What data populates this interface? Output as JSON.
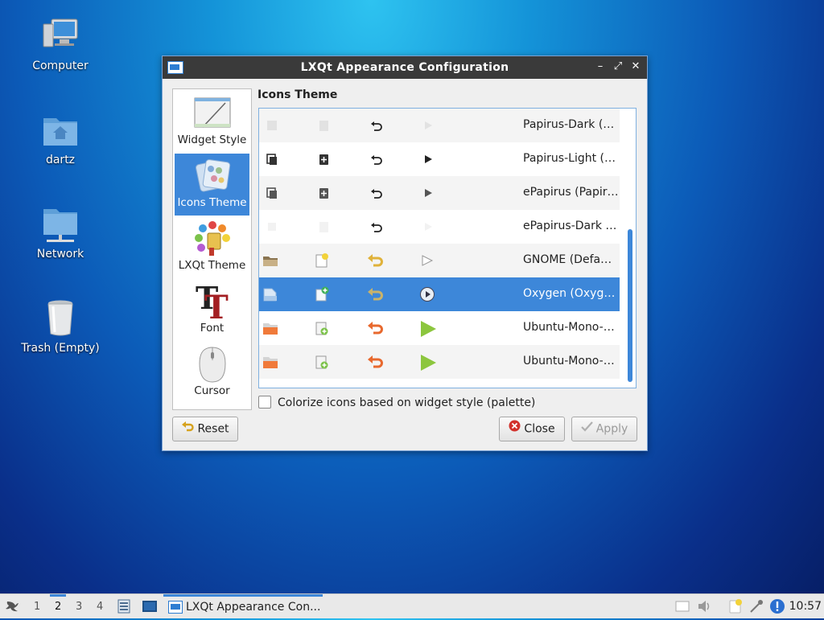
{
  "desktop": {
    "icons": [
      {
        "label": "Computer"
      },
      {
        "label": "dartz"
      },
      {
        "label": "Network"
      },
      {
        "label": "Trash (Empty)"
      }
    ]
  },
  "window": {
    "title": "LXQt Appearance Configuration",
    "buttons": {
      "minimize": "–",
      "maximize": "⤢",
      "close": "✕"
    }
  },
  "sidebar": {
    "items": [
      {
        "label": "Widget Style"
      },
      {
        "label": "Icons Theme"
      },
      {
        "label": "LXQt Theme"
      },
      {
        "label": "Font"
      },
      {
        "label": "Cursor"
      }
    ],
    "selected": "Icons Theme"
  },
  "main": {
    "section_title": "Icons Theme",
    "themes": [
      {
        "label": "Papirus-Dark (…",
        "style": "papirus-dark"
      },
      {
        "label": "Papirus-Light (…",
        "style": "papirus-light"
      },
      {
        "label": "ePapirus (Papir…",
        "style": "epapirus"
      },
      {
        "label": "ePapirus-Dark …",
        "style": "epapirus-dark"
      },
      {
        "label": "GNOME (Defa…",
        "style": "gnome"
      },
      {
        "label": "Oxygen (Oxyg…",
        "style": "oxygen",
        "selected": true
      },
      {
        "label": "Ubuntu-Mono-…",
        "style": "ubuntu"
      },
      {
        "label": "Ubuntu-Mono-…",
        "style": "ubuntu"
      }
    ],
    "colorize_label": "Colorize icons based on widget style (palette)",
    "colorize_checked": false
  },
  "footer": {
    "reset_label": "Reset",
    "close_label": "Close",
    "apply_label": "Apply"
  },
  "taskbar": {
    "workspaces": [
      "1",
      "2",
      "3",
      "4"
    ],
    "active_workspace": "2",
    "task_label": "LXQt Appearance Con...",
    "clock": "10:57"
  },
  "colors": {
    "accent": "#3d87d9",
    "titlebar": "#3a3a3a"
  }
}
